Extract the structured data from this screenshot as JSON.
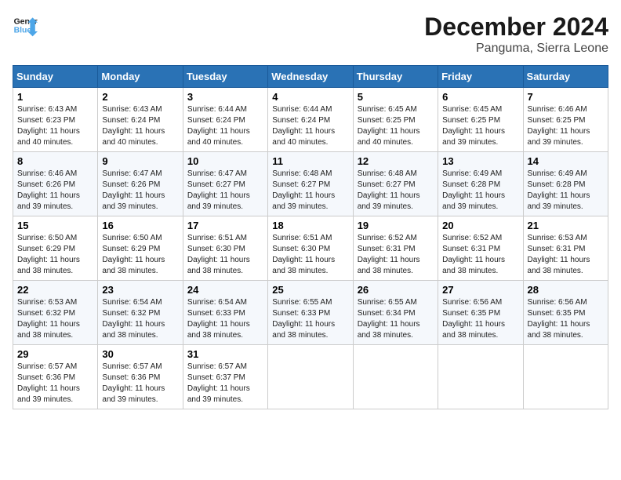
{
  "logo": {
    "line1": "General",
    "line2": "Blue"
  },
  "title": "December 2024",
  "location": "Panguma, Sierra Leone",
  "headers": [
    "Sunday",
    "Monday",
    "Tuesday",
    "Wednesday",
    "Thursday",
    "Friday",
    "Saturday"
  ],
  "weeks": [
    [
      {
        "day": "1",
        "info": "Sunrise: 6:43 AM\nSunset: 6:23 PM\nDaylight: 11 hours\nand 40 minutes."
      },
      {
        "day": "2",
        "info": "Sunrise: 6:43 AM\nSunset: 6:24 PM\nDaylight: 11 hours\nand 40 minutes."
      },
      {
        "day": "3",
        "info": "Sunrise: 6:44 AM\nSunset: 6:24 PM\nDaylight: 11 hours\nand 40 minutes."
      },
      {
        "day": "4",
        "info": "Sunrise: 6:44 AM\nSunset: 6:24 PM\nDaylight: 11 hours\nand 40 minutes."
      },
      {
        "day": "5",
        "info": "Sunrise: 6:45 AM\nSunset: 6:25 PM\nDaylight: 11 hours\nand 40 minutes."
      },
      {
        "day": "6",
        "info": "Sunrise: 6:45 AM\nSunset: 6:25 PM\nDaylight: 11 hours\nand 39 minutes."
      },
      {
        "day": "7",
        "info": "Sunrise: 6:46 AM\nSunset: 6:25 PM\nDaylight: 11 hours\nand 39 minutes."
      }
    ],
    [
      {
        "day": "8",
        "info": "Sunrise: 6:46 AM\nSunset: 6:26 PM\nDaylight: 11 hours\nand 39 minutes."
      },
      {
        "day": "9",
        "info": "Sunrise: 6:47 AM\nSunset: 6:26 PM\nDaylight: 11 hours\nand 39 minutes."
      },
      {
        "day": "10",
        "info": "Sunrise: 6:47 AM\nSunset: 6:27 PM\nDaylight: 11 hours\nand 39 minutes."
      },
      {
        "day": "11",
        "info": "Sunrise: 6:48 AM\nSunset: 6:27 PM\nDaylight: 11 hours\nand 39 minutes."
      },
      {
        "day": "12",
        "info": "Sunrise: 6:48 AM\nSunset: 6:27 PM\nDaylight: 11 hours\nand 39 minutes."
      },
      {
        "day": "13",
        "info": "Sunrise: 6:49 AM\nSunset: 6:28 PM\nDaylight: 11 hours\nand 39 minutes."
      },
      {
        "day": "14",
        "info": "Sunrise: 6:49 AM\nSunset: 6:28 PM\nDaylight: 11 hours\nand 39 minutes."
      }
    ],
    [
      {
        "day": "15",
        "info": "Sunrise: 6:50 AM\nSunset: 6:29 PM\nDaylight: 11 hours\nand 38 minutes."
      },
      {
        "day": "16",
        "info": "Sunrise: 6:50 AM\nSunset: 6:29 PM\nDaylight: 11 hours\nand 38 minutes."
      },
      {
        "day": "17",
        "info": "Sunrise: 6:51 AM\nSunset: 6:30 PM\nDaylight: 11 hours\nand 38 minutes."
      },
      {
        "day": "18",
        "info": "Sunrise: 6:51 AM\nSunset: 6:30 PM\nDaylight: 11 hours\nand 38 minutes."
      },
      {
        "day": "19",
        "info": "Sunrise: 6:52 AM\nSunset: 6:31 PM\nDaylight: 11 hours\nand 38 minutes."
      },
      {
        "day": "20",
        "info": "Sunrise: 6:52 AM\nSunset: 6:31 PM\nDaylight: 11 hours\nand 38 minutes."
      },
      {
        "day": "21",
        "info": "Sunrise: 6:53 AM\nSunset: 6:31 PM\nDaylight: 11 hours\nand 38 minutes."
      }
    ],
    [
      {
        "day": "22",
        "info": "Sunrise: 6:53 AM\nSunset: 6:32 PM\nDaylight: 11 hours\nand 38 minutes."
      },
      {
        "day": "23",
        "info": "Sunrise: 6:54 AM\nSunset: 6:32 PM\nDaylight: 11 hours\nand 38 minutes."
      },
      {
        "day": "24",
        "info": "Sunrise: 6:54 AM\nSunset: 6:33 PM\nDaylight: 11 hours\nand 38 minutes."
      },
      {
        "day": "25",
        "info": "Sunrise: 6:55 AM\nSunset: 6:33 PM\nDaylight: 11 hours\nand 38 minutes."
      },
      {
        "day": "26",
        "info": "Sunrise: 6:55 AM\nSunset: 6:34 PM\nDaylight: 11 hours\nand 38 minutes."
      },
      {
        "day": "27",
        "info": "Sunrise: 6:56 AM\nSunset: 6:35 PM\nDaylight: 11 hours\nand 38 minutes."
      },
      {
        "day": "28",
        "info": "Sunrise: 6:56 AM\nSunset: 6:35 PM\nDaylight: 11 hours\nand 38 minutes."
      }
    ],
    [
      {
        "day": "29",
        "info": "Sunrise: 6:57 AM\nSunset: 6:36 PM\nDaylight: 11 hours\nand 39 minutes."
      },
      {
        "day": "30",
        "info": "Sunrise: 6:57 AM\nSunset: 6:36 PM\nDaylight: 11 hours\nand 39 minutes."
      },
      {
        "day": "31",
        "info": "Sunrise: 6:57 AM\nSunset: 6:37 PM\nDaylight: 11 hours\nand 39 minutes."
      },
      {
        "day": "",
        "info": ""
      },
      {
        "day": "",
        "info": ""
      },
      {
        "day": "",
        "info": ""
      },
      {
        "day": "",
        "info": ""
      }
    ]
  ]
}
